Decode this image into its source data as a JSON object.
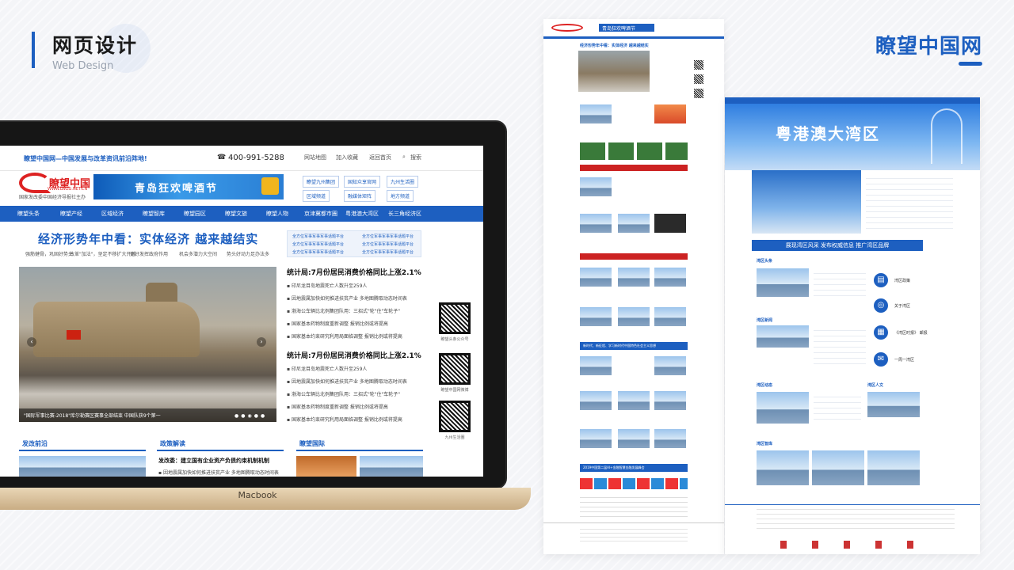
{
  "header": {
    "title": "网页设计",
    "subtitle": "Web Design",
    "brand": "瞭望中国网"
  },
  "laptop": {
    "label": "Macbook"
  },
  "site": {
    "slogan": "瞭望中国网—中国发展与改革资讯前沿阵地!",
    "phone": "400-991-5288",
    "top_links": [
      "网站地图",
      "加入收藏",
      "返回首页"
    ],
    "search_label": "搜索",
    "logo_text": "瞭望中国",
    "logo_url": "WWW.LWZG.NET.CN",
    "logo_caption": "国家发改委中国经济导报社主办",
    "banner": "青岛狂欢啤酒节",
    "quick_links": [
      "瞭望九州集团",
      "国知众享官网",
      "九州生活圈",
      "区域频道",
      "融媒体矩阵",
      "地方频道"
    ],
    "nav": [
      "瞭望头条",
      "瞭望产经",
      "区域经济",
      "瞭望智库",
      "瞭望园区",
      "瞭望文旅",
      "瞭望人物",
      "京津冀都市圈",
      "粤港澳大湾区",
      "长三角经济区"
    ],
    "headline": "经济形势年中看：实体经济 越来越结实",
    "subheads": [
      "强筋健骨，巩固好势头",
      "改革\"加法\"，坚定不移扩大开放",
      "更好发挥政府作用",
      "机会多潜力大空间",
      "势头好动力足办法多"
    ],
    "right_box": [
      "全方位军事军事军事话题平台",
      "全方位军事军事军事话题平台",
      "全方位军事军事军事话题平台",
      "全方位军事军事军事话题平台",
      "全方位军事军事军事话题平台",
      "全方位军事军事军事话题平台"
    ],
    "photo_caption": "\"国际军事比赛-2018\"库尔勒赛区赛事全部结束 中国队获9个第一",
    "news_heads": [
      "统计局:7月份居民消费价格同比上涨2.1%",
      "统计局:7月份居民消费价格同比上涨2.1%"
    ],
    "news_items": [
      "印尼龙目岛地震死亡人数升至259人",
      "因地震属加快如何推进扶贫产业 多地图腾取动态时间表",
      "渤海公车辆比北例集团队用：三招式\"轮\"住\"车轮子\"",
      "国家基本药物制度重新调整 报销比例或将提高",
      "国家基本约束研究利用局面临调整 报销比例或将提高",
      "印尼龙目岛地震死亡人数升至259人",
      "因地震属加快如何推进扶贫产业 多地图腾取动态时间表",
      "渤海公车辆比北例集团队用：三招式\"轮\"住\"车轮子\"",
      "国家基本药物制度重新调整 报销比例或将提高",
      "国家基本约束研究利用局面临调整 报销比例或将提高"
    ],
    "qr_labels": [
      "瞭望头条公众号",
      "瞭望中国网微博",
      "九州生活圈"
    ],
    "sections": [
      "发改前沿",
      "政策解读",
      "瞭望国际"
    ],
    "policy_head": "发改委：建立国有企业资产负债约束机制机制",
    "policy_item": "因地震属加快如何推进扶贫产业 多地图腾取动态时间表"
  },
  "long_page": {
    "banner": "青岛狂欢啤酒节",
    "headline": "经济形势年中看：实体经济 越来越结实",
    "strip1": "新时代、新征程、学习新时代中国特色社会主义思想",
    "strip2": "2019中国第二届AI+金融智慧金融发展峰会"
  },
  "wide_page": {
    "banner": "粤港澳大湾区",
    "strip": "展现湾区风采 发布权威信息 推广湾区品牌",
    "side_items": [
      "湾区政策",
      "关于湾区",
      "《湾区时报》 邮报",
      "一周一湾区"
    ],
    "heads": [
      "湾区头条",
      "湾区新闻",
      "湾区动态",
      "湾区人文",
      "湾区智库"
    ]
  },
  "colors": {
    "accent": "#1d5fc0",
    "red": "#dd2222"
  }
}
